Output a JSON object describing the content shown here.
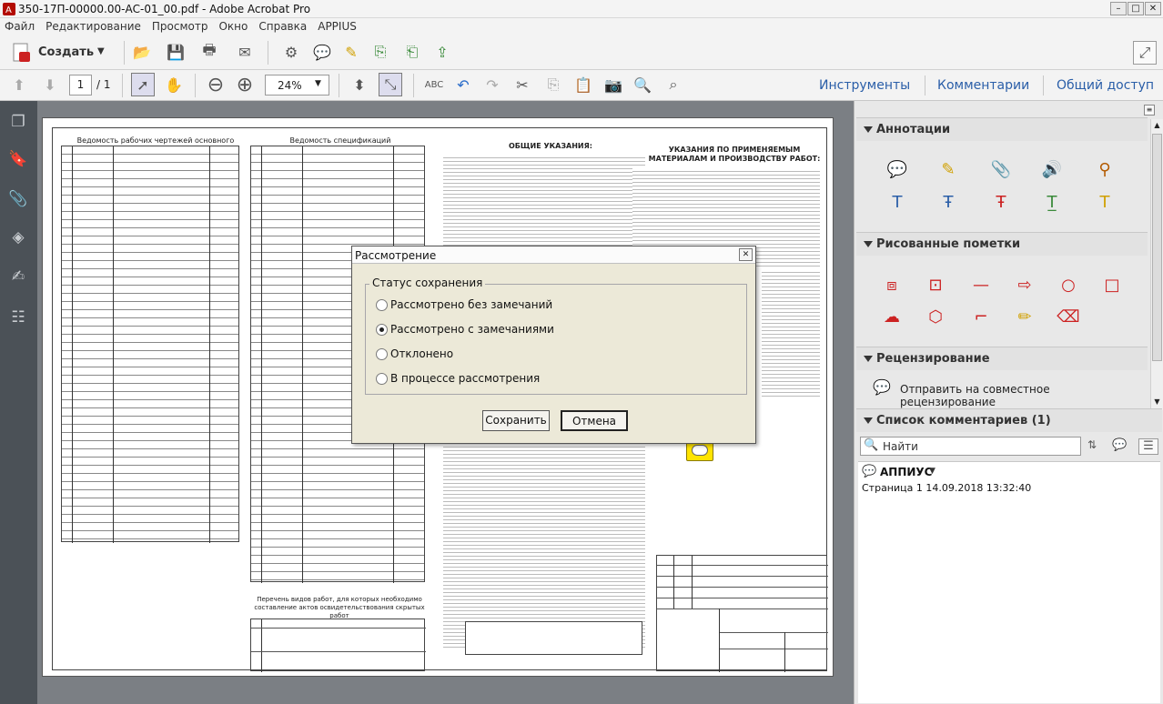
{
  "window": {
    "title": "350-17П-00000.00-АС-01_00.pdf - Adobe Acrobat Pro"
  },
  "menu": [
    "Файл",
    "Редактирование",
    "Просмотр",
    "Окно",
    "Справка",
    "APPIUS"
  ],
  "toolbar": {
    "create_label": "Создать",
    "page_current": "1",
    "page_total": "/ 1",
    "zoom": "24%"
  },
  "tabs": {
    "tools": "Инструменты",
    "comments": "Комментарии",
    "share": "Общий доступ"
  },
  "document": {
    "left_table_title": "Ведомость рабочих чертежей основного комплекта",
    "middle_table_title": "Ведомость спецификаций",
    "general_notes_title": "ОБЩИЕ УКАЗАНИЯ:",
    "materials_title": "УКАЗАНИЯ ПО ПРИМЕНЯЕМЫМ МАТЕРИАЛАМ И ПРОИЗВОДСТВУ РАБОТ:",
    "hidden_works_title": "Перечень видов работ, для которых необходимо составление актов освидетельствования скрытых работ"
  },
  "dialog": {
    "title": "Рассмотрение",
    "group_label": "Статус сохранения",
    "options": [
      "Рассмотрено без замечаний",
      "Рассмотрено с замечаниями",
      "Отклонено",
      "В процессе рассмотрения"
    ],
    "selected": "Рассмотрено с замечаниями",
    "save": "Сохранить",
    "cancel": "Отмена"
  },
  "panel": {
    "annotations": "Аннотации",
    "drawing_marks": "Рисованные пометки",
    "review": "Рецензирование",
    "review_action": "Отправить на совместное рецензирование",
    "comment_list": "Список комментариев (1)",
    "search_label": "Найти",
    "comment_author": "АППИУС",
    "comment_meta": "Страница 1  14.09.2018 13:32:40"
  },
  "colors": {
    "accent_blue": "#2a5ea8",
    "dialog_bg": "#ece9d8",
    "nav_dark": "#4b5157",
    "doc_bg": "#7b7f84"
  }
}
